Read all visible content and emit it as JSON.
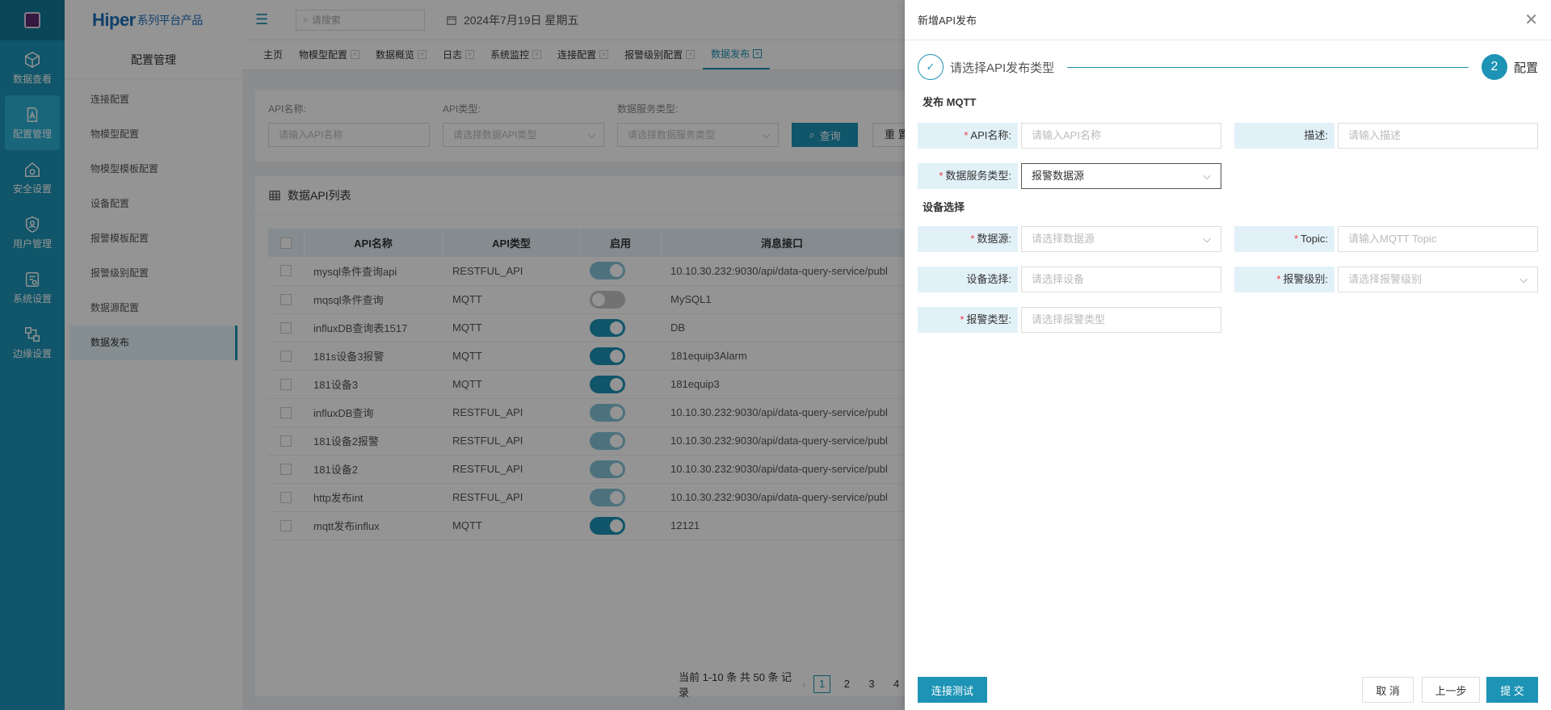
{
  "rail": [
    {
      "label": "数据查看",
      "icon": "cube-icon"
    },
    {
      "label": "配置管理",
      "icon": "config-icon",
      "active": true
    },
    {
      "label": "安全设置",
      "icon": "home-shield-icon"
    },
    {
      "label": "用户管理",
      "icon": "shield-icon"
    },
    {
      "label": "系统设置",
      "icon": "settings-icon"
    },
    {
      "label": "边缘设置",
      "icon": "edge-icon"
    }
  ],
  "brand": {
    "name": "Hiper",
    "suffix": "系列平台产品"
  },
  "submenu": {
    "title": "配置管理",
    "items": [
      "连接配置",
      "物模型配置",
      "物模型模板配置",
      "设备配置",
      "报警模板配置",
      "报警级别配置",
      "数据源配置",
      "数据发布"
    ],
    "active_index": 7
  },
  "topbar": {
    "search_placeholder": "请搜索",
    "date": "2024年7月19日 星期五"
  },
  "tabs": [
    "主页",
    "物模型配置",
    "数据概览",
    "日志",
    "系统监控",
    "连接配置",
    "报警级别配置",
    "数据发布"
  ],
  "filter": {
    "api_name_label": "API名称:",
    "api_name_placeholder": "请输入API名称",
    "api_type_label": "API类型:",
    "api_type_placeholder": "请选择数据API类型",
    "service_type_label": "数据服务类型:",
    "service_type_placeholder": "请选择数据服务类型",
    "query_button": "查询",
    "reset_button": "重 置"
  },
  "list": {
    "title": "数据API列表",
    "columns": [
      "API名称",
      "API类型",
      "启用",
      "消息接口"
    ],
    "rows": [
      {
        "name": "mysql条件查询api",
        "type": "RESTFUL_API",
        "enabled": "dim",
        "endpoint": "10.10.30.232:9030/api/data-query-service/publ"
      },
      {
        "name": "mqsql条件查询",
        "type": "MQTT",
        "enabled": "off",
        "endpoint": "MySQL1"
      },
      {
        "name": "influxDB查询表1517",
        "type": "MQTT",
        "enabled": "on",
        "endpoint": "DB"
      },
      {
        "name": "181s设备3报警",
        "type": "MQTT",
        "enabled": "on",
        "endpoint": "181equip3Alarm"
      },
      {
        "name": "181设备3",
        "type": "MQTT",
        "enabled": "on",
        "endpoint": "181equip3"
      },
      {
        "name": "influxDB查询",
        "type": "RESTFUL_API",
        "enabled": "dim",
        "endpoint": "10.10.30.232:9030/api/data-query-service/publ"
      },
      {
        "name": "181设备2报警",
        "type": "RESTFUL_API",
        "enabled": "dim",
        "endpoint": "10.10.30.232:9030/api/data-query-service/publ"
      },
      {
        "name": "181设备2",
        "type": "RESTFUL_API",
        "enabled": "dim",
        "endpoint": "10.10.30.232:9030/api/data-query-service/publ"
      },
      {
        "name": "http发布int",
        "type": "RESTFUL_API",
        "enabled": "dim",
        "endpoint": "10.10.30.232:9030/api/data-query-service/publ"
      },
      {
        "name": "mqtt发布influx",
        "type": "MQTT",
        "enabled": "on",
        "endpoint": "12121"
      }
    ],
    "pager": {
      "summary": "当前 1-10 条 共 50 条 记录",
      "pages": [
        "1",
        "2",
        "3",
        "4"
      ],
      "current": "1"
    }
  },
  "drawer": {
    "title": "新增API发布",
    "step1": "请选择API发布类型",
    "step2_number": "2",
    "step2": "配置",
    "section_publish": "发布 MQTT",
    "section_device": "设备选择",
    "api_name_label": "API名称:",
    "api_name_placeholder": "请输入API名称",
    "desc_label": "描述:",
    "desc_placeholder": "请输入描述",
    "service_type_label": "数据服务类型:",
    "service_type_value": "报警数据源",
    "datasource_label": "数据源:",
    "datasource_placeholder": "请选择数据源",
    "topic_label": "Topic:",
    "topic_placeholder": "请输入MQTT Topic",
    "device_label": "设备选择:",
    "device_placeholder": "请选择设备",
    "alarm_level_label": "报警级别:",
    "alarm_level_placeholder": "请选择报警级别",
    "alarm_type_label": "报警类型:",
    "alarm_type_placeholder": "请选择报警类型",
    "test_button": "连接测试",
    "cancel_button": "取 消",
    "prev_button": "上一步",
    "submit_button": "提 交"
  },
  "colors": {
    "accent": "#1d93b5",
    "required": "#e83a3a",
    "label_bg": "#e2f1f8"
  }
}
